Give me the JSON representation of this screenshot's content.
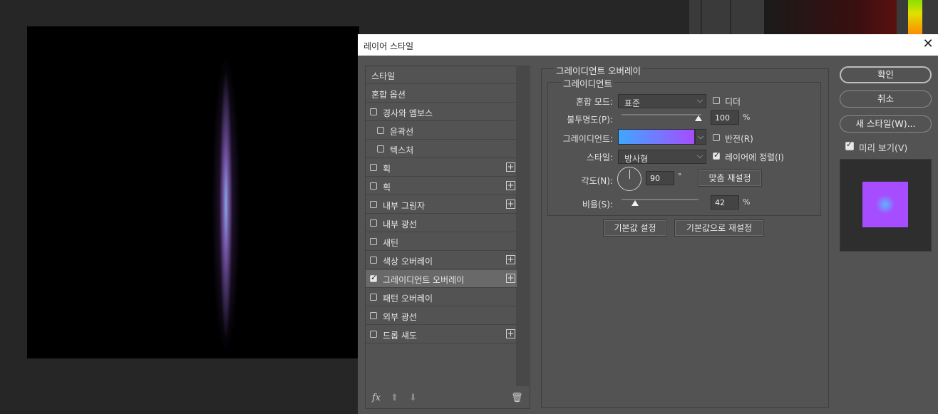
{
  "dialog": {
    "title": "레이어 스타일"
  },
  "styles_list": {
    "header": "스타일",
    "items": [
      {
        "label": "혼합 옵션",
        "checkbox": false,
        "plus": false
      },
      {
        "label": "경사와 엠보스",
        "checkbox": true,
        "checked": false,
        "plus": false
      },
      {
        "label": "윤곽선",
        "checkbox": true,
        "checked": false,
        "plus": false,
        "indent": true
      },
      {
        "label": "텍스처",
        "checkbox": true,
        "checked": false,
        "plus": false,
        "indent": true
      },
      {
        "label": "획",
        "checkbox": true,
        "checked": false,
        "plus": true
      },
      {
        "label": "획",
        "checkbox": true,
        "checked": false,
        "plus": true
      },
      {
        "label": "내부 그림자",
        "checkbox": true,
        "checked": false,
        "plus": true
      },
      {
        "label": "내부 광선",
        "checkbox": true,
        "checked": false,
        "plus": false
      },
      {
        "label": "새틴",
        "checkbox": true,
        "checked": false,
        "plus": false
      },
      {
        "label": "색상 오버레이",
        "checkbox": true,
        "checked": false,
        "plus": true
      },
      {
        "label": "그레이디언트 오버레이",
        "checkbox": true,
        "checked": true,
        "plus": true,
        "selected": true
      },
      {
        "label": "패턴 오버레이",
        "checkbox": true,
        "checked": false,
        "plus": false
      },
      {
        "label": "외부 광선",
        "checkbox": true,
        "checked": false,
        "plus": false
      },
      {
        "label": "드롭 섀도",
        "checkbox": true,
        "checked": false,
        "plus": true
      }
    ],
    "footer": {
      "fx": "fx",
      "up": "⬆",
      "down": "⬇",
      "trash": "🗑"
    }
  },
  "gradient_overlay": {
    "group_title": "그레이디언트 오버레이",
    "sub_title": "그레이디언트",
    "blend_mode_label": "혼합 모드:",
    "blend_mode_value": "표준",
    "dither_label": "디더",
    "dither_checked": false,
    "opacity_label": "불투명도(P):",
    "opacity_value": "100",
    "opacity_fraction": 1.0,
    "percent": "%",
    "gradient_label": "그레이디언트:",
    "gradient_colors": [
      "#3fa7ff",
      "#a64dff"
    ],
    "reverse_label": "반전(R)",
    "reverse_checked": false,
    "style_label": "스타일:",
    "style_value": "방사형",
    "align_label": "레이어에 정렬(I)",
    "align_checked": true,
    "angle_label": "각도(N):",
    "angle_value": "90",
    "degree": "°",
    "reset_align_label": "맞춤 재설정",
    "scale_label": "비율(S):",
    "scale_value": "42",
    "scale_fraction": 0.42,
    "make_default_label": "기본값 설정",
    "reset_default_label": "기본값으로 재설정"
  },
  "right_buttons": {
    "ok": "확인",
    "cancel": "취소",
    "new_style": "새 스타일(W)...",
    "preview_label": "미리 보기(V)",
    "preview_checked": true
  },
  "colors": {
    "gradient_start": "#3fa7ff",
    "gradient_end": "#a64dff",
    "dialog_bg": "#535353"
  }
}
